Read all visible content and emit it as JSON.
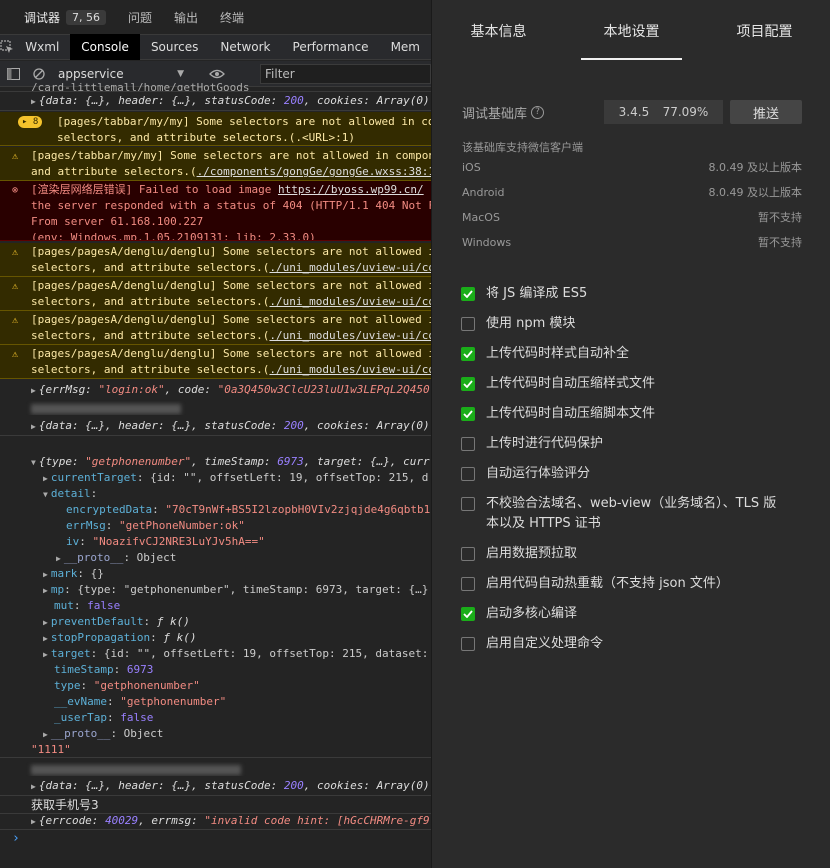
{
  "top_tabs": {
    "debugger": "调试器",
    "counts": "7, 56",
    "issues": "问题",
    "output": "输出",
    "terminal": "终端"
  },
  "panel_tabs": [
    "Wxml",
    "Console",
    "Sources",
    "Network",
    "Performance",
    "Mem"
  ],
  "filterbar": {
    "context": "appservice",
    "filter_placeholder": "Filter"
  },
  "console": {
    "l0_path": "/card-littlemall/home/getHotGoods",
    "l1": {
      "a": "{data: {…}, header: {…}, statusCode: ",
      "n": "200",
      "b": ", cookies: Array(0)"
    },
    "w1": {
      "count": "8",
      "t1": "[pages/tabbar/my/my] Some selectors are not allowed in co",
      "t2": "selectors, and attribute selectors.(.<URL>:1)"
    },
    "w2": {
      "t1": "[pages/tabbar/my/my] Some selectors are not allowed in compon",
      "t2a": "and attribute selectors.(",
      "t2l": "./components/gongGe/gongGe.wxss:38:1"
    },
    "e1": {
      "t1a": "[渲染层网络层错误] Failed to load image ",
      "t1l": "https://byoss.wp99.cn/",
      "t2": "the server responded with a status of 404 (HTTP/1.1 404 Not F",
      "t3": "From server 61.168.100.227",
      "t4": "(env: Windows,mp,1.05.2109131; lib: 2.33.0)"
    },
    "w3": {
      "t1": "[pages/pagesA/denglu/denglu] Some selectors are not allowed i",
      "t2a": "selectors, and attribute selectors.(",
      "t2l": "./uni_modules/uview-ui/co"
    },
    "w4": {
      "t1": "[pages/pagesA/denglu/denglu] Some selectors are not allowed i",
      "t2a": "selectors, and attribute selectors.(",
      "t2l": "./uni_modules/uview-ui/co"
    },
    "w5": {
      "t1": "[pages/pagesA/denglu/denglu] Some selectors are not allowed i",
      "t2a": "selectors, and attribute selectors.(",
      "t2l": "./uni_modules/uview-ui/co"
    },
    "w6": {
      "t1": "[pages/pagesA/denglu/denglu] Some selectors are not allowed i",
      "t2a": "selectors, and attribute selectors.(",
      "t2l": "./uni_modules/uview-ui/co"
    },
    "login": {
      "a": "{errMsg: ",
      "s": "\"login:ok\"",
      "b": ", code: ",
      "s2": "\"0a3Q450w3ClcU23luU1w3LEPqL2Q450"
    },
    "l2": {
      "a": "{data: {…}, header: {…}, statusCode: ",
      "n": "200",
      "b": ", cookies: Array(0)"
    },
    "evt": {
      "head_a": "{type: ",
      "head_s": "\"getphonenumber\"",
      "head_b": ", timeStamp: ",
      "head_n": "6973",
      "head_c": ", target: {…}, curr",
      "ct_k": "currentTarget",
      "ct_v": ": {id: \"\", offsetLeft: 19, offsetTop: 215, d",
      "detail_k": "detail",
      "enc_k": "encryptedData",
      "enc_v": "\"70cT9nWf+BS5I2lzopbH0VIv2zjqjde4g6qbtb1",
      "err_k": "errMsg",
      "err_v": "\"getPhoneNumber:ok\"",
      "iv_k": "iv",
      "iv_v": "\"NoazifvCJ2NRE3LuYJv5hA==\"",
      "proto1_k": "__proto__",
      "proto1_v": ": Object",
      "mark_k": "mark",
      "mark_v": ": {}",
      "mp_k": "mp",
      "mp_v": ": {type: \"getphonenumber\", timeStamp: 6973, target: {…}",
      "mut_k": "mut",
      "mut_v": "false",
      "pd_k": "preventDefault",
      "pd_v": "ƒ k()",
      "sp_k": "stopPropagation",
      "sp_v": "ƒ k()",
      "tg_k": "target",
      "tg_v": ": {id: \"\", offsetLeft: 19, offsetTop: 215, dataset:",
      "ts_k": "timeStamp",
      "ts_v": "6973",
      "ty_k": "type",
      "ty_v": "\"getphonenumber\"",
      "ev_k": "__evName",
      "ev_v": "\"getphonenumber\"",
      "ut_k": "_userTap",
      "ut_v": "false",
      "proto2_k": "__proto__",
      "proto2_v": ": Object"
    },
    "s1111": "\"1111\"",
    "l3": {
      "a": "{data: {…}, header: {…}, statusCode: ",
      "n": "200",
      "b": ", cookies: Array(0)"
    },
    "phone": "获取手机号3",
    "errcode": {
      "a": "{errcode: ",
      "n": "40029",
      "b": ", errmsg: ",
      "s": "\"invalid code hint: [hGcCHRMre-gf9"
    }
  },
  "right_tabs": [
    "基本信息",
    "本地设置",
    "项目配置"
  ],
  "lib": {
    "label": "调试基础库",
    "version": "3.4.5",
    "percent": "77.09%",
    "push": "推送"
  },
  "support": {
    "title": "该基础库支持微信客户端",
    "platforms": [
      {
        "name": "iOS",
        "value": "8.0.49 及以上版本"
      },
      {
        "name": "Android",
        "value": "8.0.49 及以上版本"
      },
      {
        "name": "MacOS",
        "value": "暂不支持"
      },
      {
        "name": "Windows",
        "value": "暂不支持"
      }
    ]
  },
  "options": [
    {
      "label": "将 JS 编译成 ES5",
      "checked": true
    },
    {
      "label": "使用 npm 模块",
      "checked": false
    },
    {
      "label": "上传代码时样式自动补全",
      "checked": true
    },
    {
      "label": "上传代码时自动压缩样式文件",
      "checked": true
    },
    {
      "label": "上传代码时自动压缩脚本文件",
      "checked": true
    },
    {
      "label": "上传时进行代码保护",
      "checked": false
    },
    {
      "label": "自动运行体验评分",
      "checked": false
    },
    {
      "label": "不校验合法域名、web-view（业务域名）、TLS 版本以及 HTTPS 证书",
      "checked": false
    },
    {
      "label": "启用数据预拉取",
      "checked": false
    },
    {
      "label": "启用代码自动热重载（不支持 json 文件）",
      "checked": false
    },
    {
      "label": "启动多核心编译",
      "checked": true
    },
    {
      "label": "启用自定义处理命令",
      "checked": false
    }
  ],
  "colors": {
    "accent": "#1aad19",
    "warn_bg": "#332b00",
    "err_bg": "#290000"
  }
}
